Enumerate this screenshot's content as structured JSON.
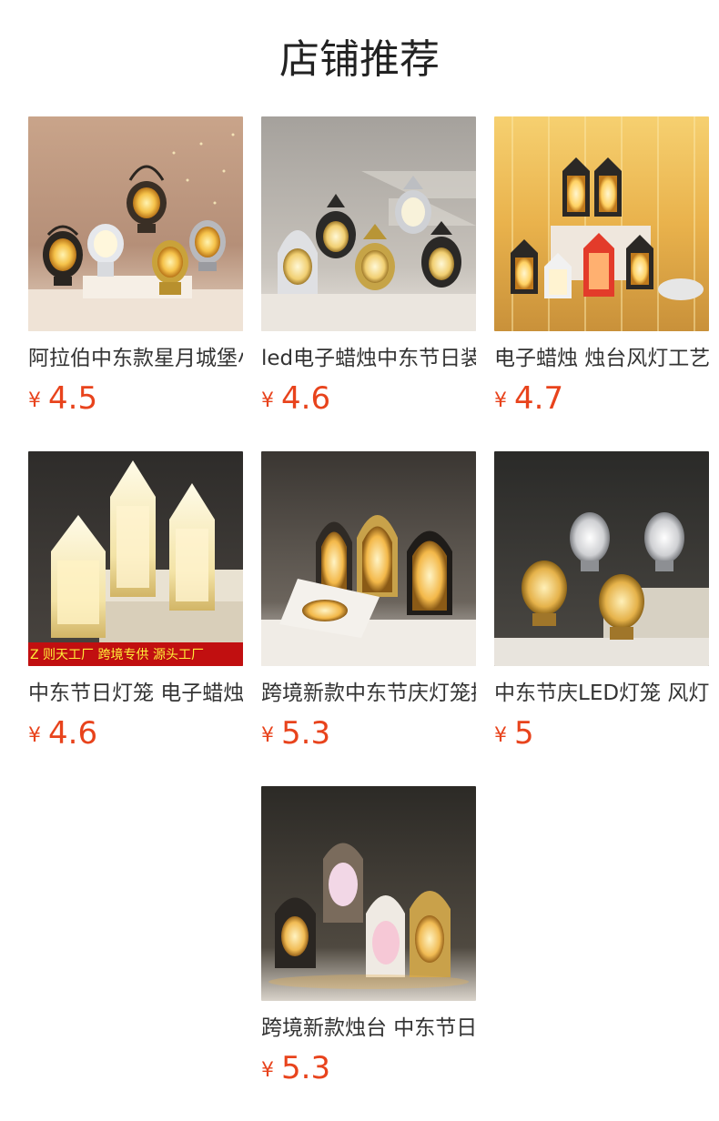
{
  "header": {
    "title": "店铺推荐"
  },
  "currency_symbol": "¥",
  "products": [
    {
      "name": "阿拉伯中东款星月城堡小风灯",
      "price": "4.5",
      "image": "lantern-photo-warm-room"
    },
    {
      "name": "led电子蜡烛中东节日装饰灯",
      "price": "4.6",
      "image": "lantern-photo-stairs"
    },
    {
      "name": "电子蜡烛 烛台风灯工艺品摆件",
      "price": "4.7",
      "image": "lantern-photo-string-lights"
    },
    {
      "name": "中东节日灯笼 电子蜡烛装饰",
      "price": "4.6",
      "image": "lantern-photo-tower",
      "watermark": "Z 则天工厂   跨境专供  源头工厂"
    },
    {
      "name": "跨境新款中东节庆灯笼摆件",
      "price": "5.3",
      "image": "lantern-photo-arch"
    },
    {
      "name": "中东节庆LED灯笼 风灯摆件",
      "price": "5",
      "image": "lantern-photo-silver-gold"
    },
    {
      "name": "跨境新款烛台 中东节日灯笼",
      "price": "5.3",
      "image": "lantern-photo-group"
    }
  ]
}
